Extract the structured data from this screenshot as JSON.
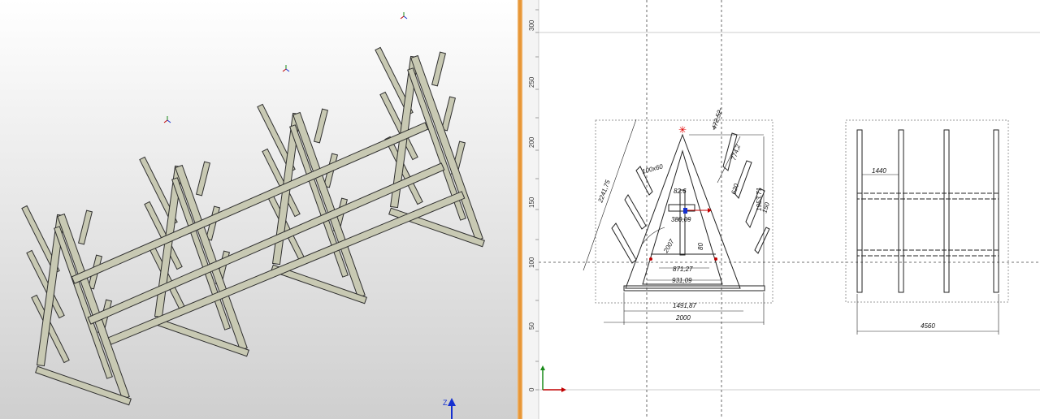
{
  "viewport3d": {
    "axis_z_label": "Z"
  },
  "drawing": {
    "ruler_ticks": [
      "300",
      "250",
      "200",
      "150",
      "100",
      "50",
      "0"
    ],
    "front_view": {
      "dims": [
        "472,52",
        "774,2",
        "1953,71",
        "2241,75",
        "100x60",
        "82.6",
        "620",
        "150",
        "380,09",
        "80",
        "2007",
        "871,27",
        "931,09",
        "1491,87",
        "2000"
      ]
    },
    "side_view": {
      "dims": [
        "1440",
        "4560"
      ]
    }
  },
  "colors": {
    "splitter": "#e58f2c",
    "steel_fill": "#c8c9b3",
    "steel_stroke": "#2e2e2e",
    "axis_x": "#c00000",
    "axis_y": "#1a8a1a",
    "axis_z": "#1530d0"
  }
}
